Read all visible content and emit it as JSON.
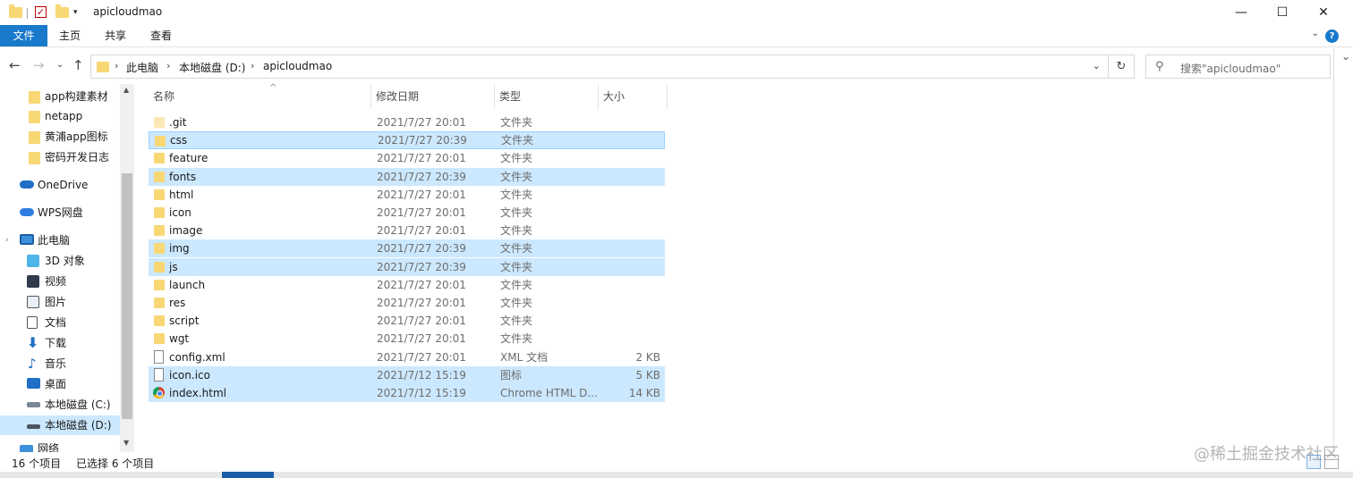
{
  "window": {
    "title": "apicloudmao",
    "minimize_glyph": "—",
    "maximize_glyph": "☐",
    "close_glyph": "✕"
  },
  "ribbon": {
    "tabs": [
      "文件",
      "主页",
      "共享",
      "查看"
    ],
    "help_glyph": "?",
    "collapse_glyph": "⌄"
  },
  "address": {
    "breadcrumbs": [
      "此电脑",
      "本地磁盘 (D:)",
      "apicloudmao"
    ],
    "separator": "›",
    "dropdown_glyph": "⌄",
    "refresh_glyph": "↻"
  },
  "search": {
    "placeholder": "搜索\"apicloudmao\""
  },
  "nav": {
    "back": "←",
    "forward": "→",
    "recent": "⌄",
    "up": "↑",
    "items": [
      {
        "label": "app构建素材",
        "icon": "folder-icon"
      },
      {
        "label": "netapp",
        "icon": "folder-icon"
      },
      {
        "label": "黄浦app图标",
        "icon": "folder-icon"
      },
      {
        "label": "密码开发日志",
        "icon": "folder-icon"
      },
      {
        "label": "OneDrive",
        "icon": "onedrive-icon"
      },
      {
        "label": "WPS网盘",
        "icon": "wps-cloud-icon"
      },
      {
        "label": "此电脑",
        "icon": "this-pc-icon"
      },
      {
        "label": "3D 对象",
        "icon": "3d-objects-icon"
      },
      {
        "label": "视频",
        "icon": "videos-icon"
      },
      {
        "label": "图片",
        "icon": "pictures-icon"
      },
      {
        "label": "文档",
        "icon": "documents-icon"
      },
      {
        "label": "下载",
        "icon": "downloads-icon"
      },
      {
        "label": "音乐",
        "icon": "music-icon"
      },
      {
        "label": "桌面",
        "icon": "desktop-icon"
      },
      {
        "label": "本地磁盘 (C:)",
        "icon": "drive-c-icon"
      },
      {
        "label": "本地磁盘 (D:)",
        "icon": "drive-d-icon"
      },
      {
        "label": "网络",
        "icon": "network-icon"
      }
    ]
  },
  "columns": {
    "name": "名称",
    "date": "修改日期",
    "type": "类型",
    "size": "大小",
    "sort_glyph": "^"
  },
  "files": [
    {
      "name": ".git",
      "date": "2021/7/27 20:01",
      "type": "文件夹",
      "size": "",
      "icon": "folder-icon",
      "selected": false
    },
    {
      "name": "css",
      "date": "2021/7/27 20:39",
      "type": "文件夹",
      "size": "",
      "icon": "folder-icon",
      "selected": true
    },
    {
      "name": "feature",
      "date": "2021/7/27 20:01",
      "type": "文件夹",
      "size": "",
      "icon": "folder-icon",
      "selected": false
    },
    {
      "name": "fonts",
      "date": "2021/7/27 20:39",
      "type": "文件夹",
      "size": "",
      "icon": "folder-icon",
      "selected": true
    },
    {
      "name": "html",
      "date": "2021/7/27 20:01",
      "type": "文件夹",
      "size": "",
      "icon": "folder-icon",
      "selected": false
    },
    {
      "name": "icon",
      "date": "2021/7/27 20:01",
      "type": "文件夹",
      "size": "",
      "icon": "folder-icon",
      "selected": false
    },
    {
      "name": "image",
      "date": "2021/7/27 20:01",
      "type": "文件夹",
      "size": "",
      "icon": "folder-icon",
      "selected": false
    },
    {
      "name": "img",
      "date": "2021/7/27 20:39",
      "type": "文件夹",
      "size": "",
      "icon": "folder-icon",
      "selected": true
    },
    {
      "name": "js",
      "date": "2021/7/27 20:39",
      "type": "文件夹",
      "size": "",
      "icon": "folder-icon",
      "selected": true
    },
    {
      "name": "launch",
      "date": "2021/7/27 20:01",
      "type": "文件夹",
      "size": "",
      "icon": "folder-icon",
      "selected": false
    },
    {
      "name": "res",
      "date": "2021/7/27 20:01",
      "type": "文件夹",
      "size": "",
      "icon": "folder-icon",
      "selected": false
    },
    {
      "name": "script",
      "date": "2021/7/27 20:01",
      "type": "文件夹",
      "size": "",
      "icon": "folder-icon",
      "selected": false
    },
    {
      "name": "wgt",
      "date": "2021/7/27 20:01",
      "type": "文件夹",
      "size": "",
      "icon": "folder-icon",
      "selected": false
    },
    {
      "name": "config.xml",
      "date": "2021/7/27 20:01",
      "type": "XML 文档",
      "size": "2 KB",
      "icon": "xml-file-icon",
      "selected": false
    },
    {
      "name": "icon.ico",
      "date": "2021/7/12 15:19",
      "type": "图标",
      "size": "5 KB",
      "icon": "ico-file-icon",
      "selected": true
    },
    {
      "name": "index.html",
      "date": "2021/7/12 15:19",
      "type": "Chrome HTML D...",
      "size": "14 KB",
      "icon": "chrome-icon",
      "selected": true
    }
  ],
  "status": {
    "item_count": "16 个项目",
    "selected_count": "已选择 6 个项目"
  },
  "watermark": "@稀土掘金技术社区"
}
